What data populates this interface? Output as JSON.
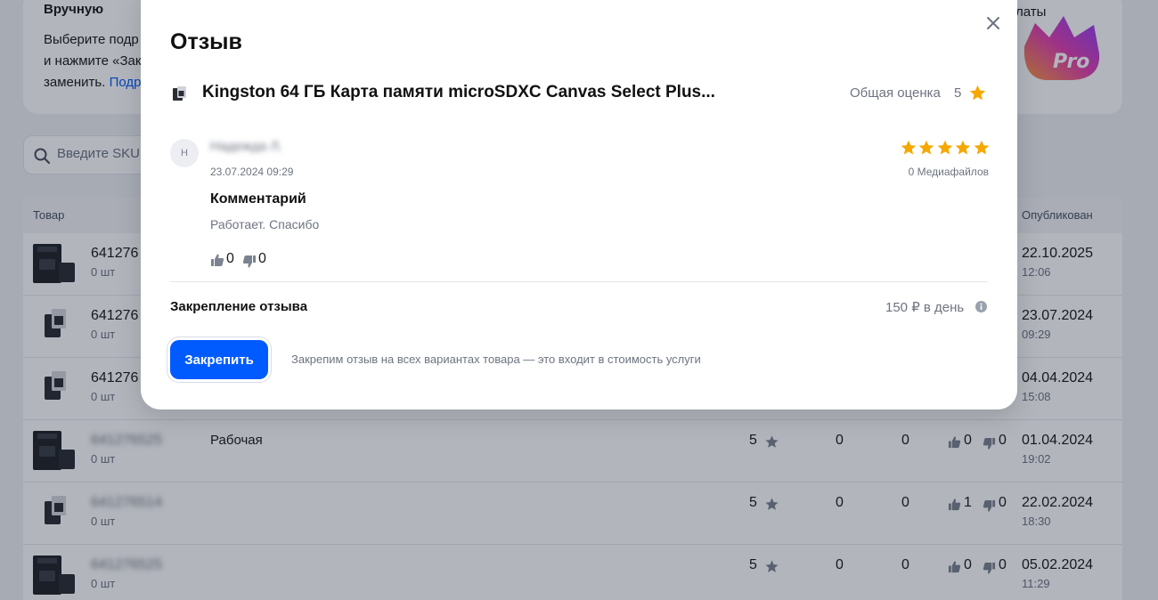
{
  "background": {
    "manual": {
      "title": "Вручную",
      "line1": "Выберите подр",
      "line2": "и нажмите «Зак",
      "line3": "заменить.",
      "link": "Подр"
    },
    "pro_fragment": "латы",
    "pro_badge_text": "Pro",
    "search": {
      "placeholder": "Введите SKU"
    },
    "table": {
      "header_product": "Товар",
      "header_published": "Опубликован",
      "rows": [
        {
          "sku": "641276",
          "qty": "0 шт",
          "comment": "",
          "rating": "",
          "media": "",
          "answers": "",
          "likes": "",
          "dislikes": "",
          "date": "22.10.2025",
          "time": "12:06"
        },
        {
          "sku": "641276",
          "qty": "0 шт",
          "comment": "",
          "rating": "",
          "media": "",
          "answers": "",
          "likes": "",
          "dislikes": "",
          "date": "23.07.2024",
          "time": "09:29"
        },
        {
          "sku": "641276",
          "qty": "0 шт",
          "comment": "",
          "rating": "",
          "media": "",
          "answers": "",
          "likes": "",
          "dislikes": "",
          "date": "04.04.2024",
          "time": "15:08"
        },
        {
          "sku": "641276525",
          "qty": "0 шт",
          "comment": "Рабочая",
          "rating": "5",
          "media": "0",
          "answers": "0",
          "likes": "0",
          "dislikes": "0",
          "date": "01.04.2024",
          "time": "19:02"
        },
        {
          "sku": "641276514",
          "qty": "0 шт",
          "comment": "",
          "rating": "5",
          "media": "0",
          "answers": "0",
          "likes": "1",
          "dislikes": "0",
          "date": "22.02.2024",
          "time": "18:30"
        },
        {
          "sku": "641276525",
          "qty": "0 шт",
          "comment": "",
          "rating": "5",
          "media": "0",
          "answers": "0",
          "likes": "0",
          "dislikes": "0",
          "date": "05.02.2024",
          "time": "11:29"
        }
      ]
    }
  },
  "modal": {
    "title": "Отзыв",
    "product_name": "Kingston 64 ГБ Карта памяти microSDXC Canvas Select Plus...",
    "overall_label": "Общая оценка",
    "overall_value": "5",
    "review": {
      "avatar_initial": "Н",
      "author": "Надежда Л.",
      "date": "23.07.2024 09:29",
      "stars": 5,
      "media_count": "0 Медиафайлов",
      "comment_label": "Комментарий",
      "comment_text": "Работает. Спасибо",
      "likes": "0",
      "dislikes": "0"
    },
    "pin": {
      "label": "Закрепление отзыва",
      "price": "150 ₽ в день",
      "button": "Закрепить",
      "note": "Закрепим отзыв на всех вариантах товара — это входит в стоимость услуги"
    }
  },
  "colors": {
    "accent": "#005bff",
    "star": "#f5a800",
    "overlay": "rgba(14, 26, 46, 0.32)"
  }
}
